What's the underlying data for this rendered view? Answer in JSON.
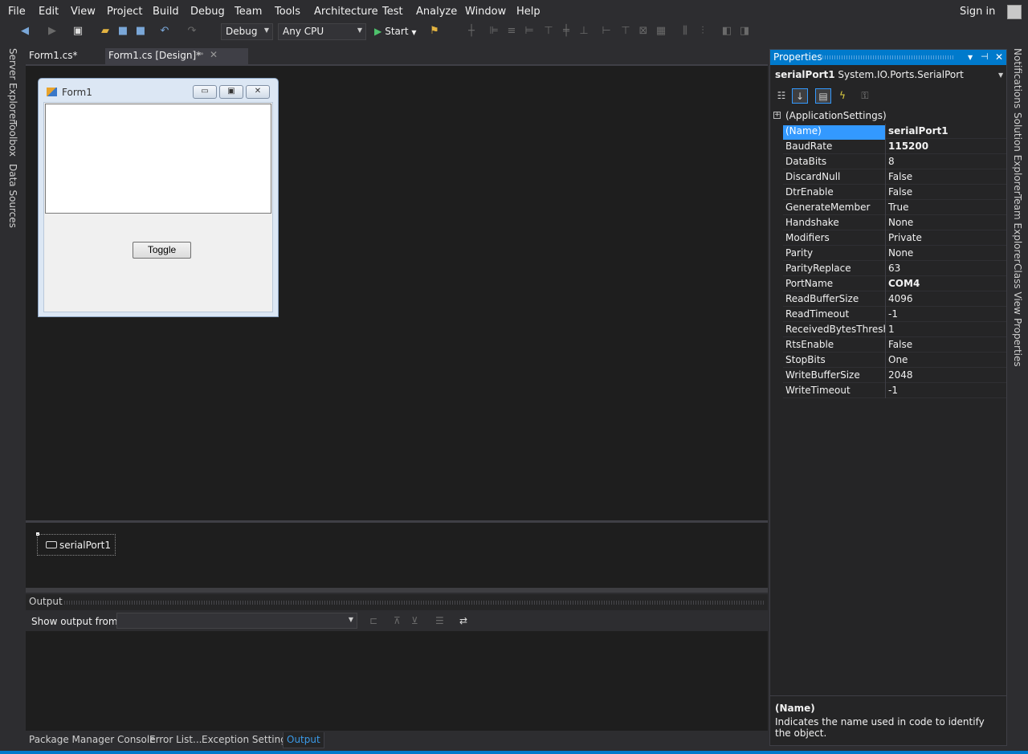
{
  "menu": [
    "File",
    "Edit",
    "View",
    "Project",
    "Build",
    "Debug",
    "Team",
    "Tools",
    "Architecture",
    "Test",
    "Analyze",
    "Window",
    "Help"
  ],
  "account": {
    "sign_in": "Sign in"
  },
  "toolbar": {
    "config": "Debug",
    "platform": "Any CPU",
    "start": "Start"
  },
  "left_tabs": [
    "Server Explorer",
    "Toolbox",
    "Data Sources"
  ],
  "right_tabs": [
    "Notifications",
    "Solution Explorer",
    "Team Explorer",
    "Class View",
    "Properties"
  ],
  "doc_tabs": [
    "Form1.cs*",
    "Form1.cs [Design]*"
  ],
  "form": {
    "title": "Form1",
    "button_label": "Toggle"
  },
  "tray": {
    "component": "serialPort1"
  },
  "output": {
    "title": "Output",
    "show_from_label": "Show output from:",
    "show_from_value": ""
  },
  "bottom_tabs": [
    "Package Manager Console",
    "Error List...",
    "Exception Settings",
    "Output"
  ],
  "properties": {
    "title": "Properties",
    "object_name": "serialPort1",
    "object_type": "System.IO.Ports.SerialPort",
    "group": "(ApplicationSettings)",
    "rows": [
      {
        "name": "(Name)",
        "value": "serialPort1",
        "bold": true
      },
      {
        "name": "BaudRate",
        "value": "115200",
        "bold": true
      },
      {
        "name": "DataBits",
        "value": "8",
        "bold": false
      },
      {
        "name": "DiscardNull",
        "value": "False",
        "bold": false
      },
      {
        "name": "DtrEnable",
        "value": "False",
        "bold": false
      },
      {
        "name": "GenerateMember",
        "value": "True",
        "bold": false
      },
      {
        "name": "Handshake",
        "value": "None",
        "bold": false
      },
      {
        "name": "Modifiers",
        "value": "Private",
        "bold": false
      },
      {
        "name": "Parity",
        "value": "None",
        "bold": false
      },
      {
        "name": "ParityReplace",
        "value": "63",
        "bold": false
      },
      {
        "name": "PortName",
        "value": "COM4",
        "bold": true
      },
      {
        "name": "ReadBufferSize",
        "value": "4096",
        "bold": false
      },
      {
        "name": "ReadTimeout",
        "value": "-1",
        "bold": false
      },
      {
        "name": "ReceivedBytesThreshold",
        "value": "1",
        "bold": false
      },
      {
        "name": "RtsEnable",
        "value": "False",
        "bold": false
      },
      {
        "name": "StopBits",
        "value": "One",
        "bold": false
      },
      {
        "name": "WriteBufferSize",
        "value": "2048",
        "bold": false
      },
      {
        "name": "WriteTimeout",
        "value": "-1",
        "bold": false
      }
    ],
    "description_title": "(Name)",
    "description_text": "Indicates the name used in code to identify the object."
  },
  "colors": {
    "accent": "#007acc",
    "selection": "#3399ff",
    "background": "#2d2d30",
    "editor": "#1e1e1e"
  }
}
